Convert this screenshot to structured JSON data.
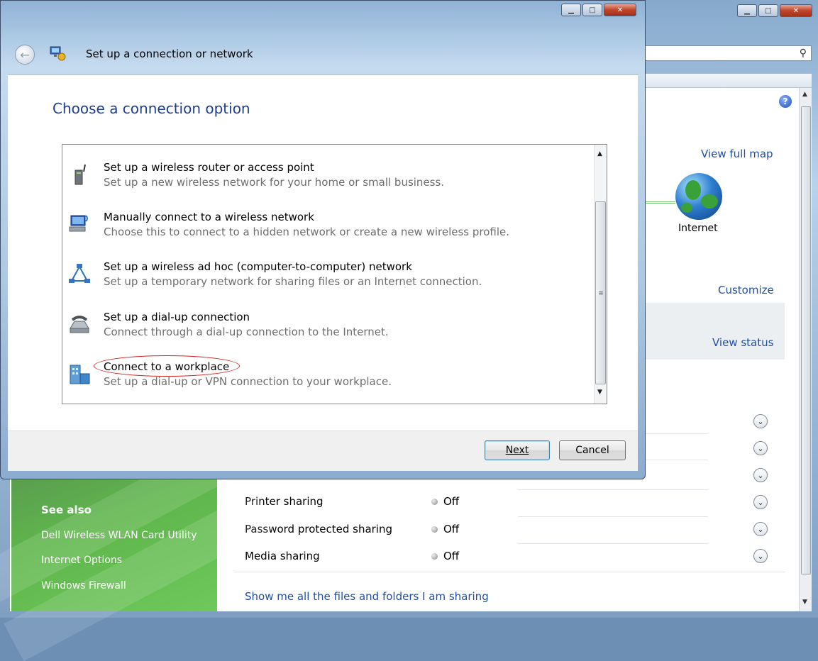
{
  "background_window": {
    "help_label": "?",
    "view_full_map": "View full map",
    "internet_label": "Internet",
    "customize": "Customize",
    "view_status": "View status",
    "sharing_rows": [
      {
        "label": "Printer sharing",
        "value": "Off"
      },
      {
        "label": "Password protected sharing",
        "value": "Off"
      },
      {
        "label": "Media sharing",
        "value": "Off"
      }
    ],
    "show_files_link": "Show me all the files and folders I am sharing",
    "see_also": {
      "title": "See also",
      "items": [
        "Dell Wireless WLAN Card Utility",
        "Internet Options",
        "Windows Firewall"
      ]
    }
  },
  "dialog": {
    "title": "Set up a connection or network",
    "heading": "Choose a connection option",
    "options": [
      {
        "title": "Set up a wireless router or access point",
        "desc": "Set up a new wireless network for your home or small business.",
        "icon": "router-icon"
      },
      {
        "title": "Manually connect to a wireless network",
        "desc": "Choose this to connect to a hidden network or create a new wireless profile.",
        "icon": "wireless-computer-icon"
      },
      {
        "title": "Set up a wireless ad hoc (computer-to-computer) network",
        "desc": "Set up a temporary network for sharing files or an Internet connection.",
        "icon": "adhoc-network-icon"
      },
      {
        "title": "Set up a dial-up connection",
        "desc": "Connect through a dial-up connection to the Internet.",
        "icon": "dialup-phone-icon"
      },
      {
        "title": "Connect to a workplace",
        "desc": "Set up a dial-up or VPN connection to your workplace.",
        "icon": "workplace-icon"
      }
    ],
    "buttons": {
      "next": "Next",
      "cancel": "Cancel"
    }
  },
  "colors": {
    "heading_blue": "#1e3d91",
    "link_blue": "#1f4fa3",
    "annotation_red": "#d3231f",
    "see_also_green": "#5fb64c"
  }
}
